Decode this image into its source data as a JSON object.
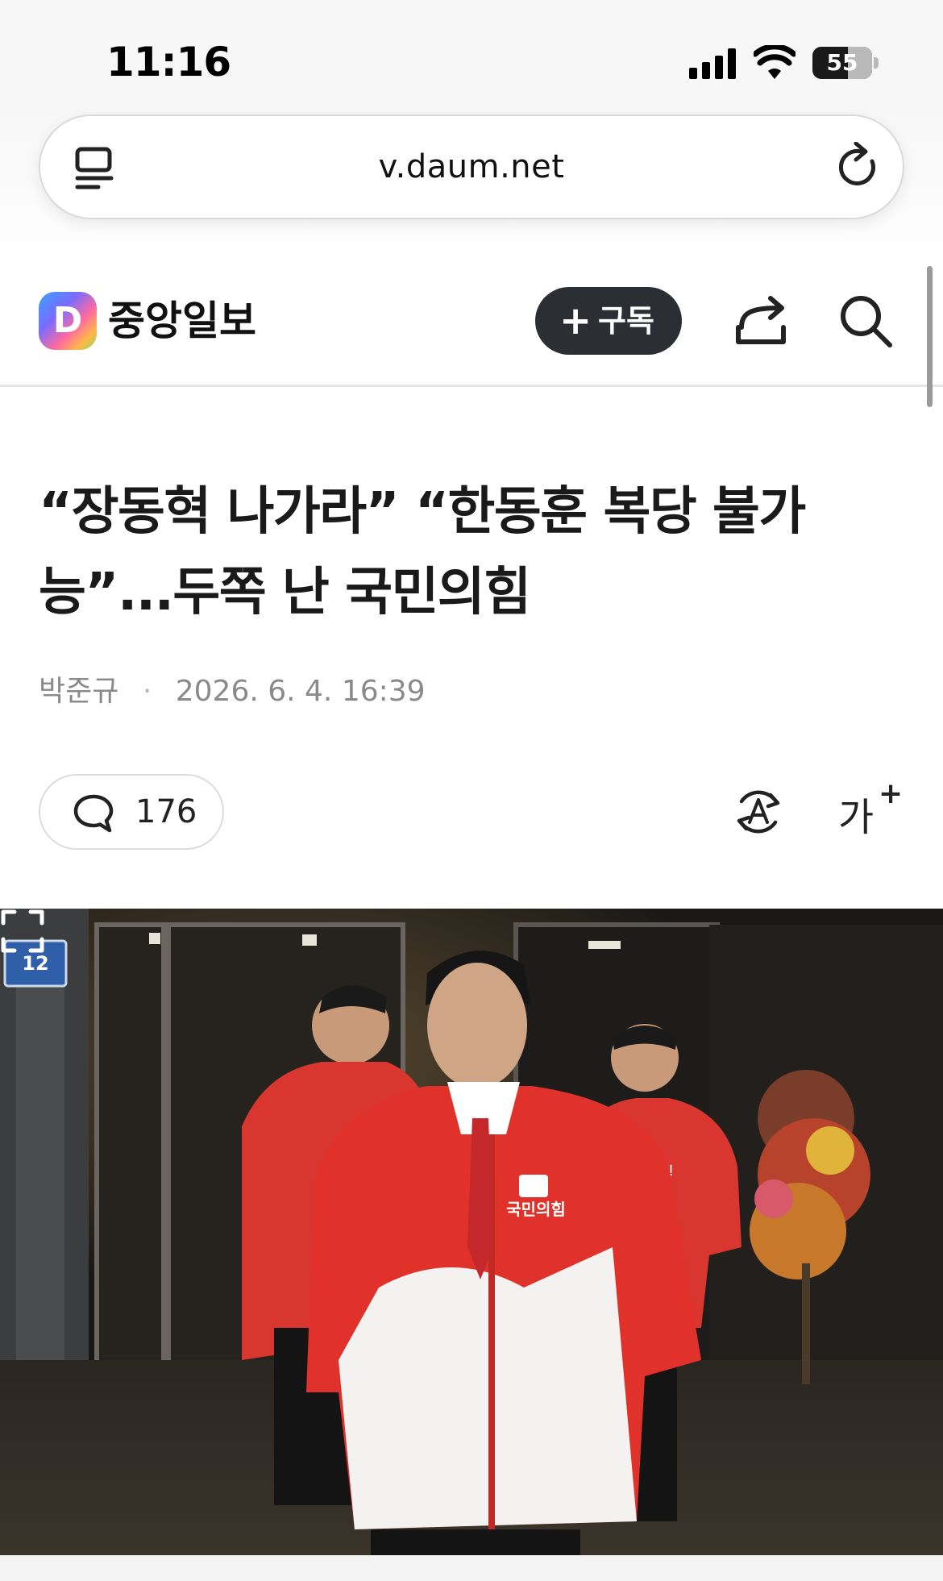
{
  "status_bar": {
    "time": "11:16",
    "battery": "55"
  },
  "browser": {
    "url": "v.daum.net"
  },
  "site_header": {
    "press_name": "중앙일보",
    "logo_letter": "D",
    "subscribe_plus": "+",
    "subscribe_label": "구독"
  },
  "article": {
    "headline_line1": "“장동혁 나가라” “한동훈 복당 불가",
    "headline_line2": "능”...두쪽 난 국민의힘",
    "author": "박준규",
    "separator": "·",
    "date": "2026. 6. 4. 16:39",
    "comment_count": "176",
    "fontsize_label": "가",
    "fontsize_plus": "+"
  },
  "photo": {
    "door_sign": "12",
    "jacket_text": "국민의힘",
    "jacket_text_small": "국민"
  },
  "colors": {
    "subscribe_bg": "#2b2e33",
    "party_red": "#e0322b",
    "meta_gray": "#8a8a8a"
  },
  "icons": [
    "reader-mode-icon",
    "reload-icon",
    "share-icon",
    "search-icon",
    "comment-icon",
    "translate-icon",
    "font-size-icon",
    "expand-icon"
  ]
}
